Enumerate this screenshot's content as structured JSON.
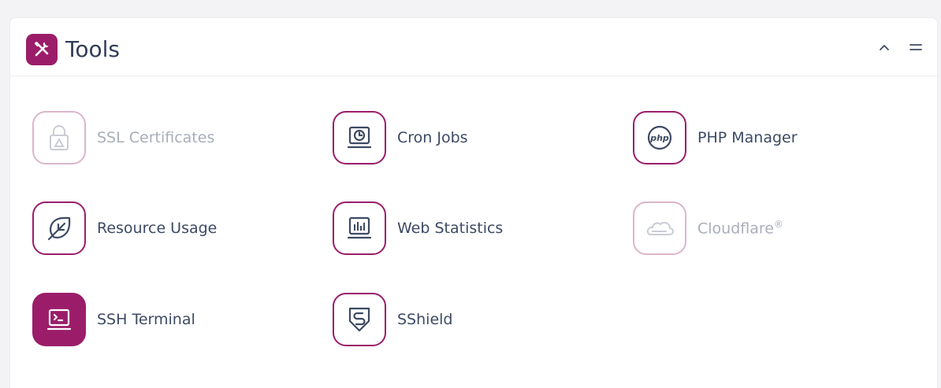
{
  "panel": {
    "title": "Tools",
    "accent_color": "#9b1d6a",
    "header_icon": "tools-icon",
    "collapse_icon": "chevron-up-icon",
    "menu_icon": "menu-icon"
  },
  "tools": [
    {
      "label": "SSL Certificates",
      "icon": "lock-icon",
      "state": "disabled"
    },
    {
      "label": "Cron Jobs",
      "icon": "clock-monitor-icon",
      "state": "normal"
    },
    {
      "label": "PHP Manager",
      "icon": "php-icon",
      "state": "normal"
    },
    {
      "label": "Resource Usage",
      "icon": "leaf-icon",
      "state": "normal"
    },
    {
      "label": "Web Statistics",
      "icon": "bar-chart-monitor-icon",
      "state": "normal"
    },
    {
      "label": "Cloudflare",
      "label_sup": "®",
      "icon": "cloud-icon",
      "state": "disabled"
    },
    {
      "label": "SSH Terminal",
      "icon": "terminal-icon",
      "state": "active"
    },
    {
      "label": "SShield",
      "icon": "shield-icon",
      "state": "normal"
    }
  ]
}
